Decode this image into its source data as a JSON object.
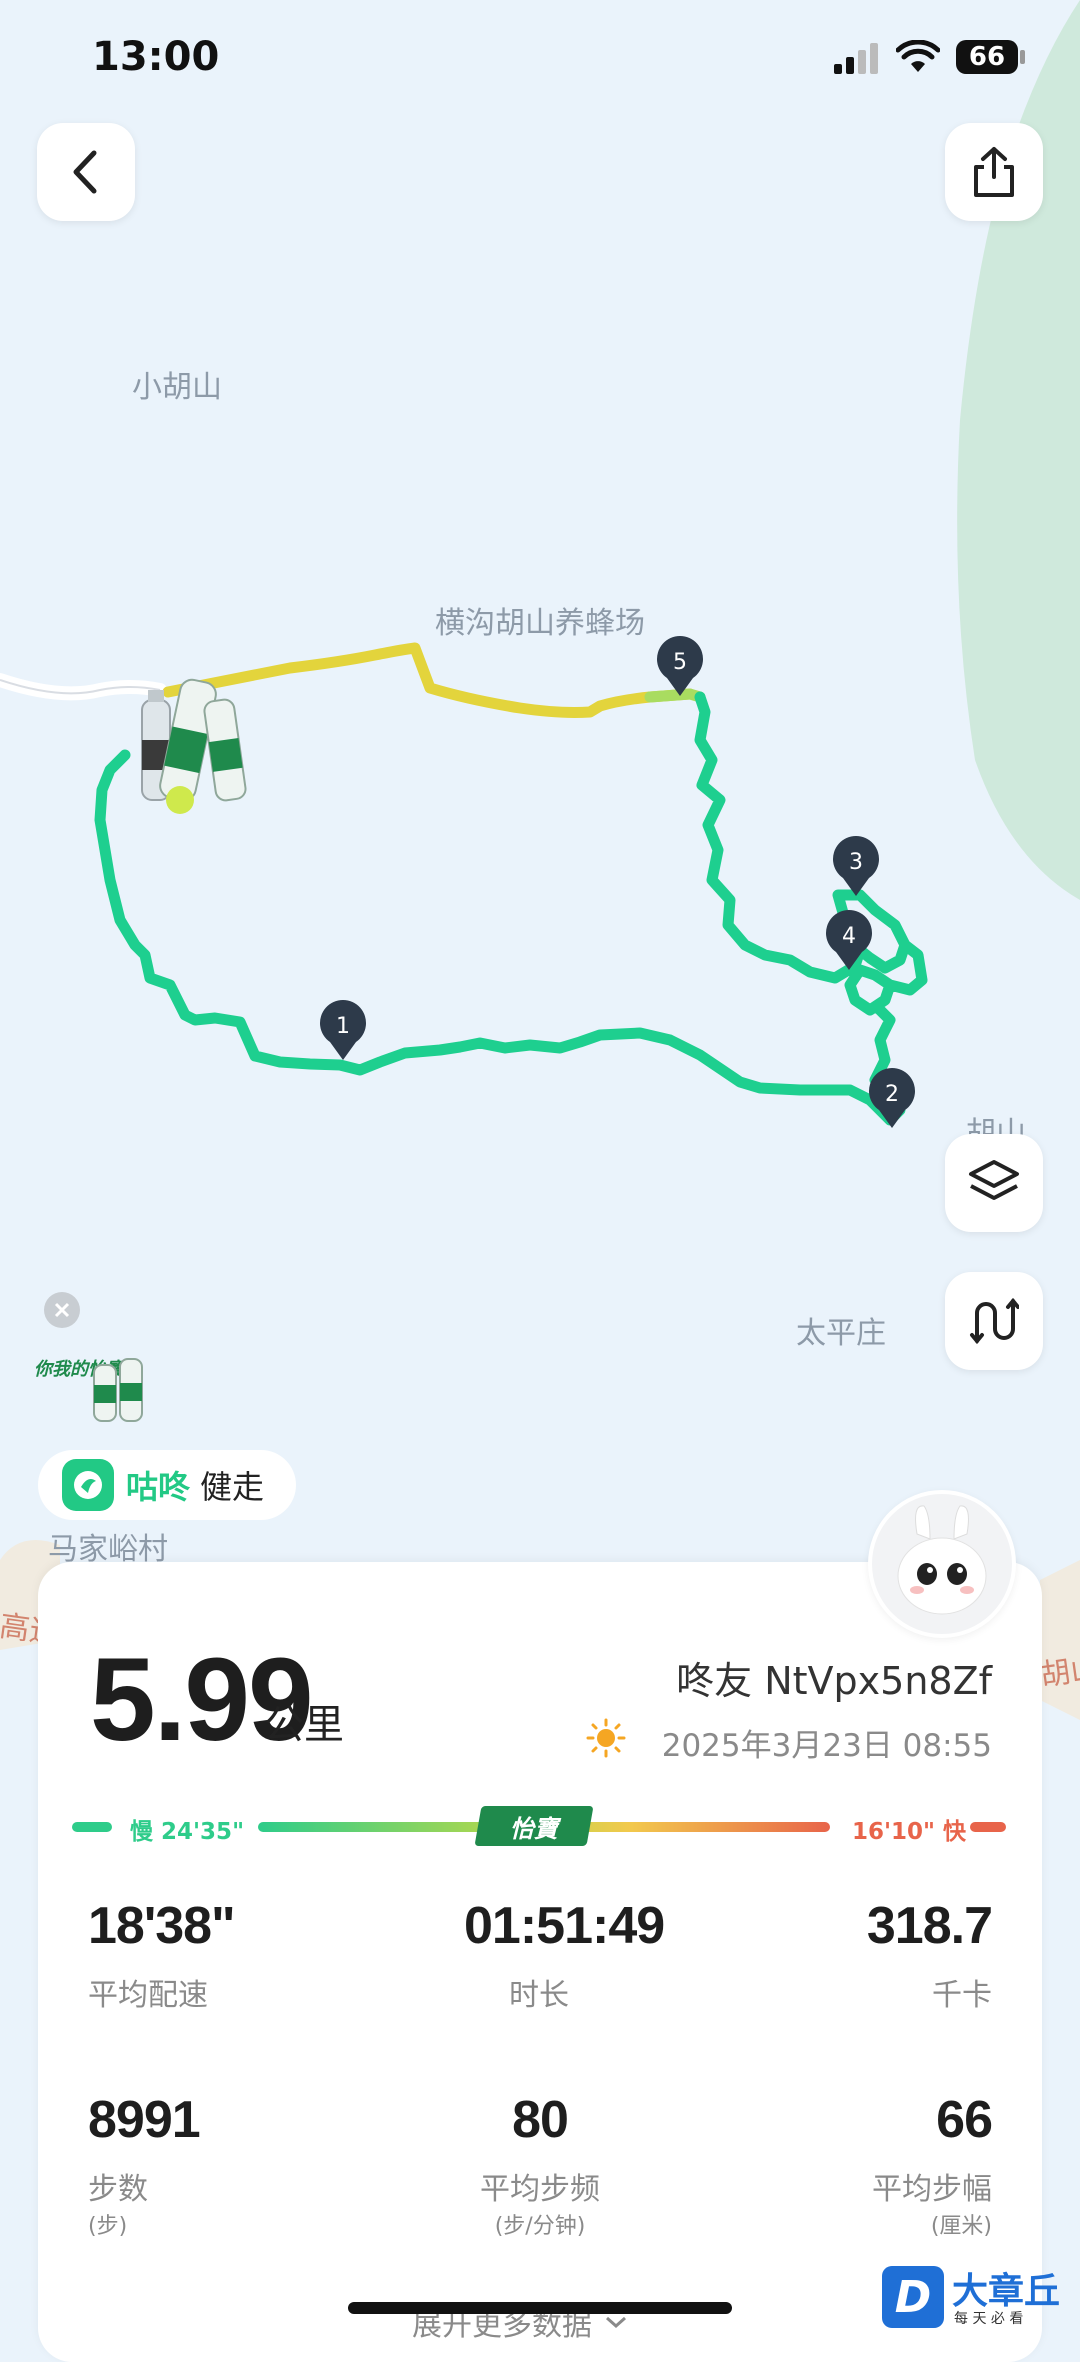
{
  "status_bar": {
    "time": "13:00",
    "battery": "66"
  },
  "map": {
    "places": {
      "xiaohushan": "小胡山",
      "beekeeping": "横沟胡山养蜂场",
      "hushan": "胡山",
      "taipingzhuang": "太平庄",
      "majiayu": "马家峪村",
      "highway": "高速",
      "hu_right": "胡山"
    },
    "markers": [
      "1",
      "2",
      "3",
      "4",
      "5"
    ]
  },
  "brand": {
    "gudong": "咕咚",
    "mode": "健走",
    "sponsor_tagline": "你我的怡寶",
    "sponsor": "怡寶"
  },
  "summary": {
    "distance": "5.99",
    "distance_unit": "公里",
    "user": "咚友 NtVpx5n8Zf",
    "date": "2025年3月23日 08:55"
  },
  "pace_bar": {
    "slow": "慢 24'35\"",
    "fast": "16'10\" 快"
  },
  "stats": {
    "avg_pace": {
      "value": "18'38\"",
      "label": "平均配速"
    },
    "duration": {
      "value": "01:51:49",
      "label": "时长"
    },
    "calories": {
      "value": "318.7",
      "label": "千卡"
    },
    "steps": {
      "value": "8991",
      "label": "步数",
      "unit": "(步)"
    },
    "cadence": {
      "value": "80",
      "label": "平均步频",
      "unit": "(步/分钟)"
    },
    "stride": {
      "value": "66",
      "label": "平均步幅",
      "unit": "(厘米)"
    }
  },
  "expand_label": "展开更多数据",
  "watermark": {
    "text": "大章丘",
    "sub": "每 天 必 看"
  },
  "colors": {
    "route": "#1ecf8f",
    "route_slow": "#e6d63c",
    "accent_fast": "#e8644a"
  }
}
